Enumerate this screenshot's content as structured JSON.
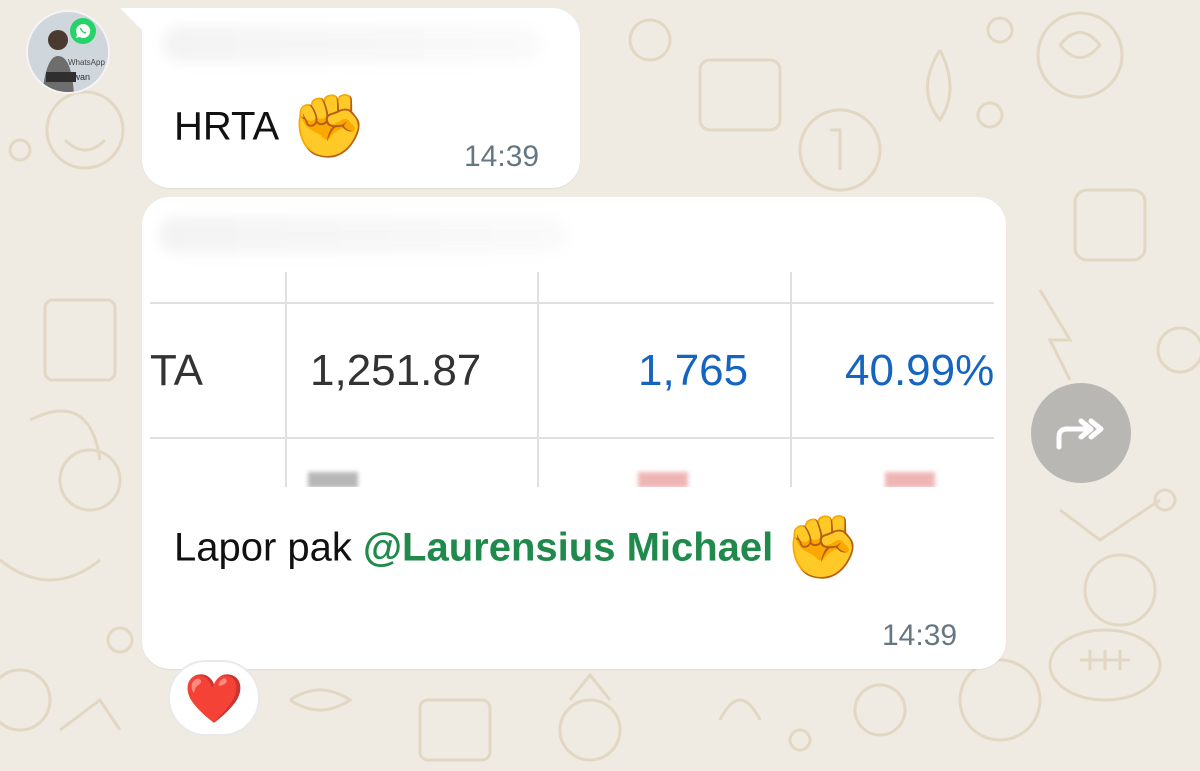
{
  "messages": [
    {
      "text": "HRTA",
      "emoji": "✊",
      "time": "14:39"
    },
    {
      "table": {
        "row1": [
          "TA",
          "1,251.87",
          "1,765",
          "40.99%"
        ]
      },
      "text_prefix": "Lapor pak",
      "mention": "@Laurensius Michael",
      "emoji": "✊",
      "time": "14:39"
    }
  ],
  "avatar": {
    "badge_text": "WhatsApp",
    "name": "Irwan"
  },
  "reaction": "❤️",
  "icons": {
    "forward": "forward-icon",
    "whatsapp": "whatsapp-icon"
  },
  "colors": {
    "mention": "#1f8a4c",
    "positive": "#1565c0",
    "negative": "#d32f2f",
    "timestamp": "#667781"
  }
}
